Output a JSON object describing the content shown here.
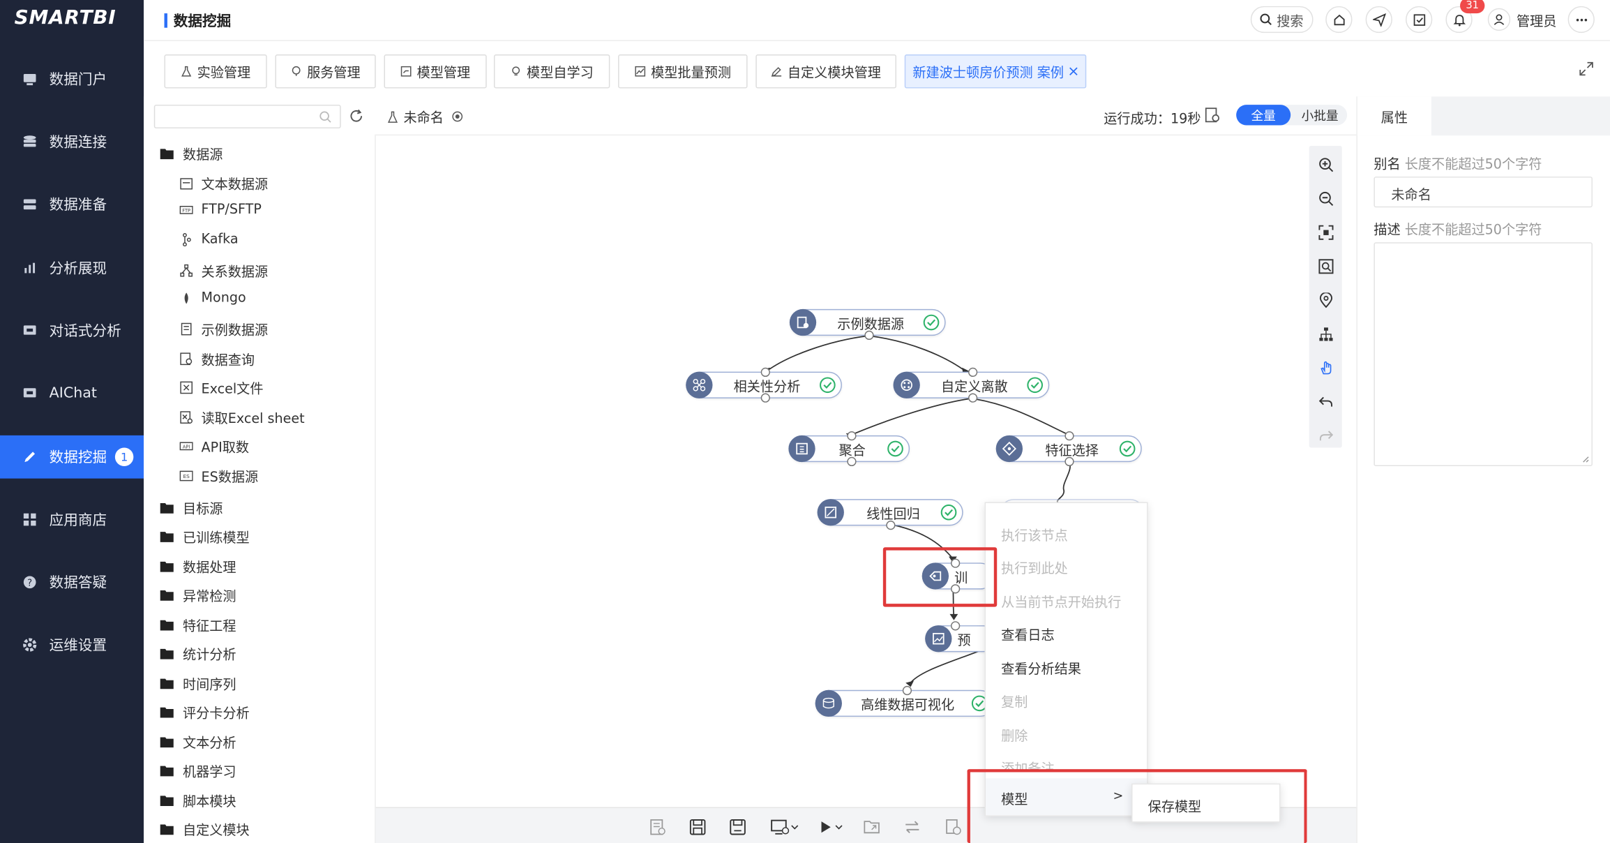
{
  "app": {
    "logo": "SMARTBI",
    "breadcrumb": "数据挖掘"
  },
  "nav": {
    "items": [
      {
        "label": "数据门户",
        "icon": "monitor-icon"
      },
      {
        "label": "数据连接",
        "icon": "database-icon"
      },
      {
        "label": "数据准备",
        "icon": "server-icon"
      },
      {
        "label": "分析展现",
        "icon": "bar-chart-icon"
      },
      {
        "label": "对话式分析",
        "icon": "chat-icon"
      },
      {
        "label": "AIChat",
        "icon": "aichat-icon"
      },
      {
        "label": "数据挖掘",
        "icon": "pen-icon",
        "badge": "1",
        "active": true
      },
      {
        "label": "应用商店",
        "icon": "apps-icon"
      },
      {
        "label": "数据答疑",
        "icon": "question-icon"
      },
      {
        "label": "运维设置",
        "icon": "gear-icon"
      }
    ]
  },
  "topbar": {
    "search": "搜索",
    "notif_count": "31",
    "user": "管理员"
  },
  "tabs": [
    {
      "label": "实验管理"
    },
    {
      "label": "服务管理"
    },
    {
      "label": "模型管理"
    },
    {
      "label": "模型自学习"
    },
    {
      "label": "模型批量预测"
    },
    {
      "label": "自定义模块管理"
    },
    {
      "label": "新建波士顿房价预测 案例",
      "active": true
    }
  ],
  "tree": {
    "datasource": "数据源",
    "children": [
      "文本数据源",
      "FTP/SFTP",
      "Kafka",
      "关系数据源",
      "Mongo",
      "示例数据源",
      "数据查询",
      "Excel文件",
      "读取Excel sheet",
      "API取数",
      "ES数据源"
    ],
    "folders": [
      "目标源",
      "已训练模型",
      "数据处理",
      "异常检测",
      "特征工程",
      "统计分析",
      "时间序列",
      "评分卡分析",
      "文本分析",
      "机器学习",
      "脚本模块",
      "自定义模块"
    ]
  },
  "canvas": {
    "name": "未命名",
    "status": "运行成功：19秒",
    "mode_full": "全量",
    "mode_small": "小批量",
    "nodes": {
      "n1": "示例数据源",
      "n2": "相关性分析",
      "n3": "自定义离散",
      "n4": "聚合",
      "n5": "特征选择",
      "n6": "线性回归",
      "n7": "训",
      "n8": "预",
      "n9": "高维数据可视化"
    }
  },
  "props": {
    "tab": "属性",
    "alias_label": "别名",
    "alias_hint": "长度不能超过50个字符",
    "alias_value": "未命名",
    "desc_label": "描述",
    "desc_hint": "长度不能超过50个字符"
  },
  "menu": {
    "items": [
      {
        "label": "执行该节点",
        "disabled": true
      },
      {
        "label": "执行到此处",
        "disabled": true
      },
      {
        "label": "从当前节点开始执行",
        "disabled": true
      },
      {
        "label": "查看日志",
        "disabled": false
      },
      {
        "label": "查看分析结果",
        "disabled": false
      },
      {
        "label": "复制",
        "disabled": true
      },
      {
        "label": "删除",
        "disabled": true
      },
      {
        "label": "添加备注",
        "disabled": true
      }
    ],
    "model": "模型",
    "arrow": ">",
    "submenu": "保存模型"
  },
  "colors": {
    "accent": "#2b6ff7",
    "nav_bg": "#1e2538",
    "highlight": "#e03a3a",
    "success": "#2fb36a"
  }
}
